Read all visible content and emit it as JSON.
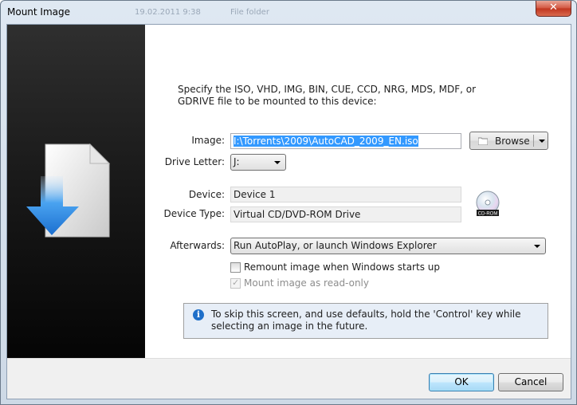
{
  "window": {
    "title": "Mount Image",
    "ghost_title_1": "19.02.2011 9:38",
    "ghost_title_2": "File folder",
    "close_glyph": "✕"
  },
  "intro_text": "Specify the ISO, VHD, IMG, BIN, CUE, CCD, NRG, MDS, MDF, or GDRIVE file to be mounted to this device:",
  "form": {
    "image_label": "Image:",
    "image_value": "I:\\Torrents\\2009\\AutoCAD_2009_EN.iso",
    "browse_label": "Browse",
    "drive_letter_label": "Drive Letter:",
    "drive_letter_value": "J:",
    "device_label": "Device:",
    "device_value": "Device 1",
    "device_type_label": "Device Type:",
    "device_type_value": "Virtual CD/DVD-ROM Drive",
    "cd_badge": "CD-ROM",
    "afterwards_label": "Afterwards:",
    "afterwards_value": "Run AutoPlay, or launch Windows Explorer"
  },
  "options": [
    {
      "label": "Remount image when Windows starts up",
      "checked": false,
      "disabled": false
    },
    {
      "label": "Mount image as read-only",
      "checked": true,
      "disabled": true
    }
  ],
  "info": {
    "icon": "info-icon",
    "text": "To skip this screen, and use defaults, hold the 'Control' key while selecting an image in the future."
  },
  "buttons": {
    "ok": "OK",
    "cancel": "Cancel"
  },
  "colors": {
    "accent": "#3399ff",
    "info_icon": "#1f6fc9",
    "side_panel": "#1a1a1a",
    "arrow_blue": "#2f8ee6"
  }
}
